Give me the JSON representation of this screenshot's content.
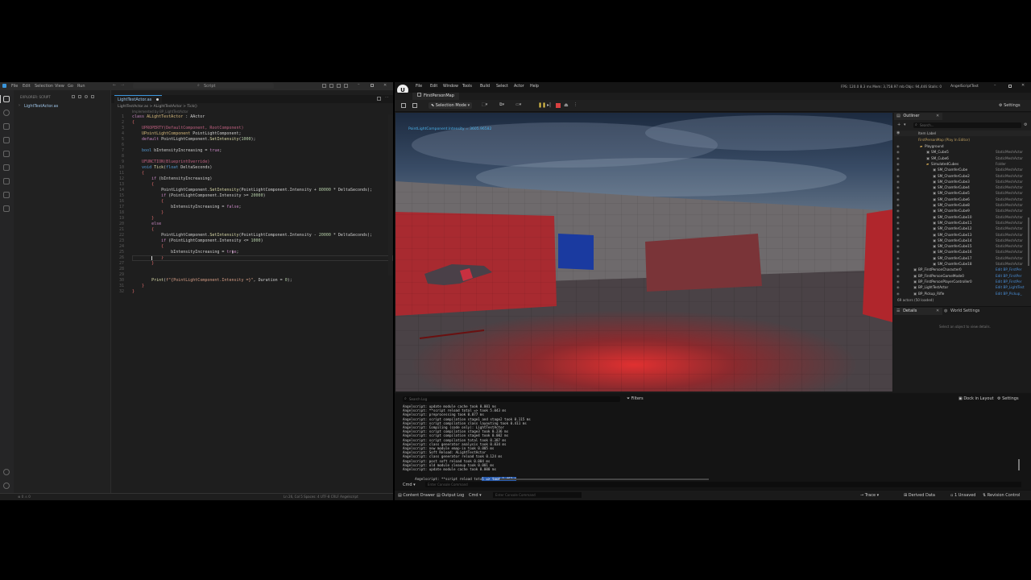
{
  "vscode": {
    "menu": [
      "File",
      "Edit",
      "Selection",
      "View",
      "Go",
      "Run"
    ],
    "search_placeholder": "Script",
    "explorer_title": "EXPLORER: SCRIPT",
    "files": [
      "LightTestActor.as"
    ],
    "tab": "LightTestActor.as",
    "breadcrumb": "LightTestActor.as > ALightTestActor > Tick()",
    "hint": "Implemented by BP_LightTestActor",
    "code": [
      {
        "n": "1",
        "html": "<span class='kw'>class</span> <span class='ty'>ALightTestActor</span> <span class='id'>: AActor</span>"
      },
      {
        "n": "2",
        "html": "<span class='red'>{</span>"
      },
      {
        "n": "3",
        "html": "    <span class='mac'>UPROPERTY(DefaultComponent, RootComponent)</span>"
      },
      {
        "n": "4",
        "html": "    <span class='ty'>UPointLightComponent</span> <span class='id'>PointLightComponent;</span>"
      },
      {
        "n": "5",
        "html": "    <span class='kw'>default</span> <span class='id'>PointLightComponent.</span><span class='fn'>SetIntensity</span><span class='id'>(</span><span class='num'>1000</span><span class='id'>);</span>"
      },
      {
        "n": "6",
        "html": ""
      },
      {
        "n": "7",
        "html": "    <span class='bl'>bool</span> <span class='id'>bIntensityIncreasing = </span><span class='kw'>true</span><span class='id'>;</span>"
      },
      {
        "n": "8",
        "html": ""
      },
      {
        "n": "9",
        "html": "    <span class='mac'>UFUNCTION(BlueprintOverride)</span>"
      },
      {
        "n": "10",
        "html": "    <span class='bl'>void</span> <span class='fn'>Tick</span><span class='id'>(</span><span class='bl'>float</span> <span class='id'>DeltaSeconds)</span>"
      },
      {
        "n": "11",
        "html": "    <span class='red'>{</span>"
      },
      {
        "n": "12",
        "html": "        <span class='kw'>if</span> <span class='id'>(bIntensityIncreasing)</span>"
      },
      {
        "n": "13",
        "html": "        <span class='red'>{</span>"
      },
      {
        "n": "14",
        "html": "            <span class='id'>PointLightComponent.</span><span class='fn'>SetIntensity</span><span class='id'>(PointLightComponent.Intensity + </span><span class='num'>80000</span><span class='id'> * DeltaSeconds);</span>"
      },
      {
        "n": "15",
        "html": "            <span class='kw'>if</span> <span class='id'>(PointLightComponent.Intensity &gt;= </span><span class='num'>20000</span><span class='id'>)</span>"
      },
      {
        "n": "16",
        "html": "            <span class='red'>{</span>"
      },
      {
        "n": "17",
        "html": "                <span class='id'>bIntensityIncreasing = </span><span class='kw'>false</span><span class='id'>;</span>"
      },
      {
        "n": "18",
        "html": "            <span class='red'>}</span>"
      },
      {
        "n": "19",
        "html": "        <span class='red'>}</span>"
      },
      {
        "n": "20",
        "html": "        <span class='kw'>else</span>"
      },
      {
        "n": "21",
        "html": "        <span class='red'>{</span>"
      },
      {
        "n": "22",
        "html": "            <span class='id'>PointLightComponent.</span><span class='fn'>SetIntensity</span><span class='id'>(PointLightComponent.Intensity - </span><span class='num'>20000</span><span class='id'> * DeltaSeconds);</span>"
      },
      {
        "n": "23",
        "html": "            <span class='kw'>if</span> <span class='id'>(PointLightComponent.Intensity &lt;= </span><span class='num'>1000</span><span class='id'>)</span>"
      },
      {
        "n": "24",
        "html": "            <span class='red'>{</span>"
      },
      {
        "n": "25",
        "html": "                <span class='id'>bIntensityIncreasing = </span><span class='kw'>true</span><span class='id'>;</span>"
      },
      {
        "n": "26",
        "html": "            <span class='red'>}</span>"
      },
      {
        "n": "27",
        "html": "        <span class='red'>}</span>"
      },
      {
        "n": "28",
        "html": ""
      },
      {
        "n": "29",
        "html": ""
      },
      {
        "n": "30",
        "html": "        <span class='fn'>Print</span><span class='id'>(</span><span class='str'>f\"{PointLightComponent.Intensity =}\"</span><span class='id'>, Duration = </span><span class='num'>0</span><span class='id'>);</span>"
      },
      {
        "n": "31",
        "html": "    <span class='red'>}</span>"
      },
      {
        "n": "32",
        "html": "<span class='red'>}</span>"
      }
    ],
    "status": {
      "left": "⊗ 0 ⚠ 0",
      "right": "Ln 26, Col 5   Spaces: 4   UTF-8   CRLF   Angelscript"
    }
  },
  "unreal": {
    "menu": [
      "File",
      "Edit",
      "Window",
      "Tools",
      "Build",
      "Select",
      "Actor",
      "Help"
    ],
    "stats": "FPS: 120.0   8.3 ms   Mem: 3,758.97 mb   Objs: 94,446   Stalls: 0",
    "project": "AngelScriptTest",
    "map_tab": "FirstPersonMap",
    "selection_mode": "Selection Mode",
    "settings": "Settings",
    "viewport_print": "PointLightComponent.Intensity = 3605.96582",
    "outliner": {
      "title": "Outliner",
      "search_placeholder": "Search...",
      "column": "Item Label",
      "root": "FirstPersonMap (Play In Editor)",
      "rows": [
        {
          "name": "Playground",
          "type": "",
          "indent": 2,
          "folder": true
        },
        {
          "name": "SM_Cube5",
          "type": "StaticMeshActor",
          "indent": 3
        },
        {
          "name": "SM_Cube6",
          "type": "StaticMeshActor",
          "indent": 3
        },
        {
          "name": "SimulatedCubes",
          "type": "Folder",
          "indent": 3,
          "folder": true
        },
        {
          "name": "SM_ChamferCube",
          "type": "StaticMeshActor",
          "indent": 4
        },
        {
          "name": "SM_ChamferCube2",
          "type": "StaticMeshActor",
          "indent": 4
        },
        {
          "name": "SM_ChamferCube3",
          "type": "StaticMeshActor",
          "indent": 4
        },
        {
          "name": "SM_ChamferCube4",
          "type": "StaticMeshActor",
          "indent": 4
        },
        {
          "name": "SM_ChamferCube5",
          "type": "StaticMeshActor",
          "indent": 4
        },
        {
          "name": "SM_ChamferCube6",
          "type": "StaticMeshActor",
          "indent": 4
        },
        {
          "name": "SM_ChamferCube8",
          "type": "StaticMeshActor",
          "indent": 4
        },
        {
          "name": "SM_ChamferCube9",
          "type": "StaticMeshActor",
          "indent": 4
        },
        {
          "name": "SM_ChamferCube10",
          "type": "StaticMeshActor",
          "indent": 4
        },
        {
          "name": "SM_ChamferCube11",
          "type": "StaticMeshActor",
          "indent": 4
        },
        {
          "name": "SM_ChamferCube12",
          "type": "StaticMeshActor",
          "indent": 4
        },
        {
          "name": "SM_ChamferCube13",
          "type": "StaticMeshActor",
          "indent": 4
        },
        {
          "name": "SM_ChamferCube14",
          "type": "StaticMeshActor",
          "indent": 4
        },
        {
          "name": "SM_ChamferCube15",
          "type": "StaticMeshActor",
          "indent": 4
        },
        {
          "name": "SM_ChamferCube16",
          "type": "StaticMeshActor",
          "indent": 4
        },
        {
          "name": "SM_ChamferCube17",
          "type": "StaticMeshActor",
          "indent": 4
        },
        {
          "name": "SM_ChamferCube18",
          "type": "StaticMeshActor",
          "indent": 4
        },
        {
          "name": "BP_FirstPersonCharacter0",
          "type": "Edit BP_FirstPer",
          "indent": 1,
          "link": true
        },
        {
          "name": "BP_FirstPersonGameMode0",
          "type": "Edit BP_FirstPer",
          "indent": 1,
          "link": true
        },
        {
          "name": "BP_FirstPersonPlayerController0",
          "type": "Edit BP_FirstPer",
          "indent": 1,
          "link": true
        },
        {
          "name": "BP_LightTestActor",
          "type": "Edit BP_LightTest",
          "indent": 1,
          "link": true
        },
        {
          "name": "BP_Pickup_Rifle",
          "type": "Edit BP_Pickup_",
          "indent": 1,
          "link": true
        }
      ],
      "count": "69 actors (50 loaded)"
    },
    "details": {
      "tab": "Details",
      "tab2": "World Settings",
      "empty": "Select an object to view details."
    },
    "log": {
      "search_placeholder": "Search Log",
      "filters": "Filters",
      "dock": "Dock in Layout",
      "settings": "Settings",
      "lines": [
        "Angelscript: update module cache took 0.001 ms",
        "Angelscript: **script reload total => took 5.043 ms",
        "Angelscript: preprocessing took 0.077 ms",
        "Angelscript: script compilation stage1 and stage2 took 0.115 ms",
        "Angelscript: script compilation class layouting took 0.411 ms",
        "Angelscript: Compiling (code only): LightTestActor",
        "Angelscript: script compilation stage3 took 0.236 ms",
        "Angelscript: script compilation stage4 took 0.002 ms",
        "Angelscript: script compilation total took 0.387 ms",
        "Angelscript: class generator analysis took 0.034 ms",
        "Angelscript: new module emap-in took 0.005 ms",
        "Angelscript: Soft Reload: ALightTestActor",
        "Angelscript: class generator reload took 0.124 ms",
        "Angelscript: post soft reload took 0.004 ms",
        "Angelscript: old module cleanup took 0.001 ms",
        "Angelscript: update module cache took 0.000 ms"
      ],
      "last_line_prefix": "Angelscript: **script reload tota",
      "last_line_highlight": "l => took 1.463 m",
      "cmd": "Cmd",
      "cmd_placeholder": "Enter Console Command"
    },
    "bottom": {
      "items": [
        "Content Drawer",
        "Output Log",
        "Cmd"
      ],
      "cmd_placeholder": "Enter Console Command",
      "right": [
        "Trace",
        "Derived Data",
        "1 Unsaved",
        "Revision Control"
      ]
    }
  }
}
